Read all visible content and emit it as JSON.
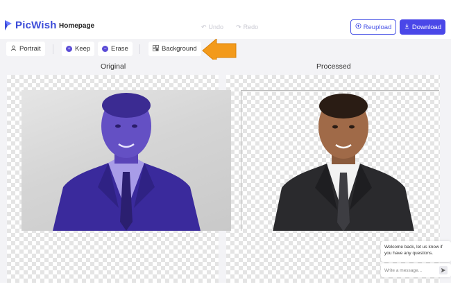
{
  "app": {
    "name": "PicWish",
    "brand_color": "#3b4bd8",
    "accent_color": "#4a47e8"
  },
  "header": {
    "home_label": "Homepage",
    "undo_label": "Undo",
    "redo_label": "Redo",
    "reupload_label": "Reupload",
    "download_label": "Download"
  },
  "toolbar": {
    "portrait_label": "Portrait",
    "keep_label": "Keep",
    "erase_label": "Erase",
    "background_label": "Background"
  },
  "panels": {
    "original_title": "Original",
    "processed_title": "Processed"
  },
  "chat": {
    "message": "Welcome back, let us know if you have any questions.",
    "input_placeholder": "Write a message..."
  },
  "icons": {
    "logo": "picwish-logo-icon",
    "undo": "undo-icon",
    "redo": "redo-icon",
    "reupload": "upload-cloud-icon",
    "download": "download-icon",
    "portrait": "person-icon",
    "keep": "plus-circle-icon",
    "erase": "minus-circle-icon",
    "background": "background-grid-icon",
    "send": "send-icon",
    "annotation": "orange-arrow-icon"
  }
}
